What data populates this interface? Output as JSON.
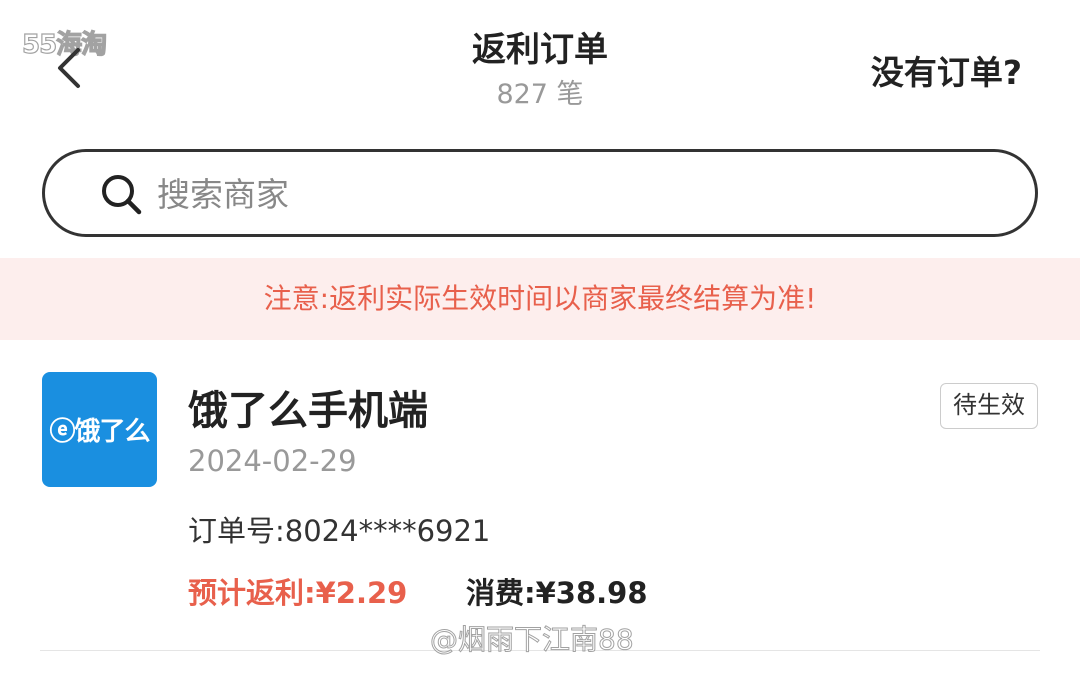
{
  "watermark_top": "55海淘",
  "header": {
    "title": "返利订单",
    "subtitle": "827 笔",
    "no_order_link": "没有订单?"
  },
  "search": {
    "placeholder": "搜索商家"
  },
  "notice": "注意:返利实际生效时间以商家最终结算为准!",
  "orders": [
    {
      "logo_text": "ⓔ饿了么",
      "merchant": "饿了么手机端",
      "date": "2024-02-29",
      "order_no": "订单号:8024****6921",
      "rebate": "预计返利:¥2.29",
      "spend": "消费:¥38.98",
      "status": "待生效"
    }
  ],
  "watermark_bottom": "@烟雨下江南88",
  "colors": {
    "accent": "#e8604c",
    "notice_bg": "#fdeeed",
    "logo_bg": "#1a8fe0"
  }
}
